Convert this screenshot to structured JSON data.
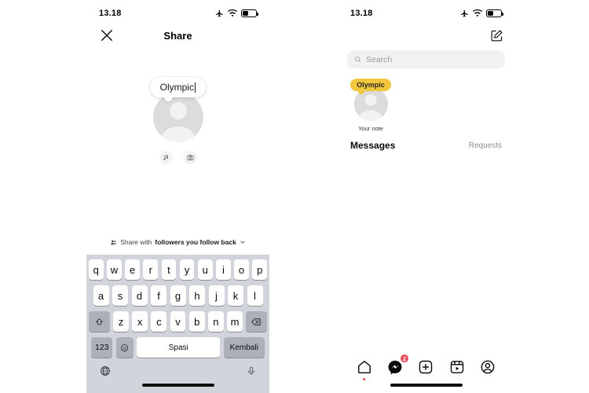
{
  "left_phone": {
    "status": {
      "time": "13.18",
      "airplane_icon": "airplane-icon",
      "wifi_icon": "wifi-icon",
      "battery_icon": "battery-icon",
      "battery_level": 45
    },
    "header": {
      "close_icon": "close-icon",
      "title": "Share"
    },
    "composer": {
      "note_text": "Olympic",
      "avatar_icon": "avatar-placeholder",
      "music_icon": "music-note-icon",
      "camera_icon": "camera-icon"
    },
    "audience": {
      "people_icon": "people-icon",
      "prefix": "Share with",
      "target": "followers you follow back",
      "chevron_icon": "chevron-down-icon"
    },
    "keyboard": {
      "row1": [
        "q",
        "w",
        "e",
        "r",
        "t",
        "y",
        "u",
        "i",
        "o",
        "p"
      ],
      "row2": [
        "a",
        "s",
        "d",
        "f",
        "g",
        "h",
        "j",
        "k",
        "l"
      ],
      "row3": [
        "z",
        "x",
        "c",
        "v",
        "b",
        "n",
        "m"
      ],
      "shift_icon": "shift-icon",
      "backspace_icon": "backspace-icon",
      "numbers_label": "123",
      "emoji_icon": "emoji-icon",
      "space_label": "Spasi",
      "return_label": "Kembali",
      "globe_icon": "globe-icon",
      "mic_icon": "microphone-icon"
    }
  },
  "right_phone": {
    "status": {
      "time": "13.18",
      "airplane_icon": "airplane-icon",
      "wifi_icon": "wifi-icon",
      "battery_icon": "battery-icon",
      "battery_level": 45
    },
    "header": {
      "compose_icon": "compose-icon"
    },
    "search": {
      "icon": "search-icon",
      "placeholder": "Search",
      "value": ""
    },
    "notes_tray": {
      "note_text": "Olympic",
      "avatar_icon": "avatar-placeholder",
      "caption": "Your note"
    },
    "messages": {
      "title": "Messages",
      "requests_label": "Requests"
    },
    "tabbar": {
      "home_icon": "home-icon",
      "messages_icon": "messenger-icon",
      "messages_badge": "2",
      "create_icon": "plus-square-icon",
      "reels_icon": "reels-icon",
      "profile_icon": "profile-icon"
    }
  },
  "colors": {
    "note_yellow": "#f2c73d",
    "badge_red": "#ed4956",
    "keyboard_bg": "#d1d4db",
    "key_dark": "#abb0ba",
    "search_bg": "#f1f1f2"
  }
}
